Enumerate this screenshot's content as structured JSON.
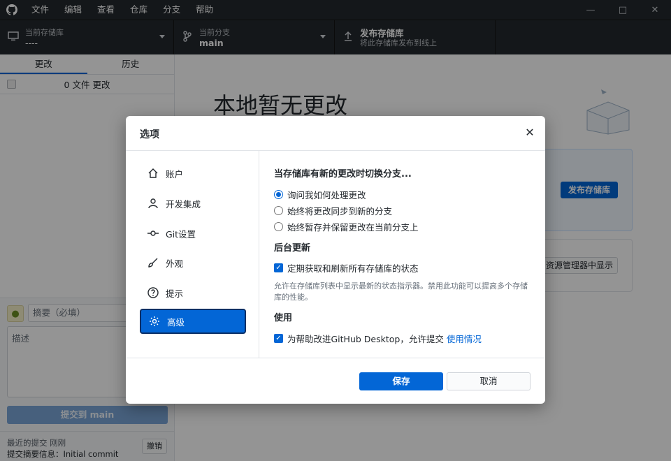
{
  "menu": [
    "文件",
    "编辑",
    "查看",
    "仓库",
    "分支",
    "帮助"
  ],
  "window_controls": [
    "minimize-icon",
    "maximize-icon",
    "close-icon"
  ],
  "toolbar": {
    "repo": {
      "label": "当前存储库",
      "value": "----"
    },
    "branch": {
      "label": "当前分支",
      "value": "main"
    },
    "publish": {
      "label": "发布存储库",
      "sub": "将此存储库发布到线上"
    }
  },
  "sidebar": {
    "tabs": [
      "更改",
      "历史"
    ],
    "changes_count": "0 文件 更改",
    "summary_placeholder": "摘要（必填）",
    "description_placeholder": "描述",
    "commit_button": "提交到 main",
    "last_commit_label": "最近的提交 刚刚",
    "last_commit_message": "提交摘要信息：Initial commit",
    "undo_button": "撤销"
  },
  "main": {
    "title": "本地暂无更改",
    "publish_button": "发布存储库",
    "show_in_explorer_button": "资源管理器中显示"
  },
  "dialog": {
    "title": "选项",
    "nav": [
      {
        "label": "账户",
        "icon": "home-icon"
      },
      {
        "label": "开发集成",
        "icon": "person-icon"
      },
      {
        "label": "Git设置",
        "icon": "git-commit-icon"
      },
      {
        "label": "外观",
        "icon": "paintbrush-icon"
      },
      {
        "label": "提示",
        "icon": "question-icon"
      },
      {
        "label": "高级",
        "icon": "gear-icon"
      }
    ],
    "selected_nav": "高级",
    "section1_title": "当存储库有新的更改时切换分支...",
    "radios": [
      "询问我如何处理更改",
      "始终将更改同步到新的分支",
      "始终暂存并保留更改在当前分支上"
    ],
    "section2_title": "后台更新",
    "background_check": "定期获取和刷新所有存储库的状态",
    "background_note": "允许在存储库列表中显示最新的状态指示器。禁用此功能可以提高多个存储库的性能。",
    "section3_title": "使用",
    "usage_check": "为帮助改进GitHub Desktop，允许提交",
    "usage_link": "使用情况",
    "save_button": "保存",
    "cancel_button": "取消"
  },
  "colors": {
    "accent": "#0366d6",
    "titlebar": "#24292e"
  }
}
